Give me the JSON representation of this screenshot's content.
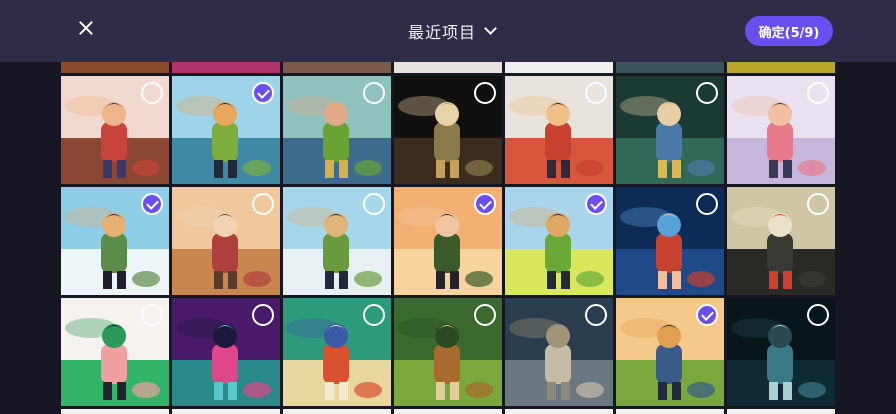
{
  "header": {
    "close_icon": "close-icon",
    "album_title": "最近项目",
    "album_dropdown_icon": "chevron-down-icon",
    "confirm_label": "确定(5/9)"
  },
  "colors": {
    "header_bg": "#2e2c47",
    "accent": "#6a4ff0",
    "page_bg": "#171623"
  },
  "selection": {
    "selected_count": 5,
    "max_count": 9
  },
  "grid": {
    "columns": 7,
    "top_partial_row": [
      "#8a4a2c",
      "#b0346a",
      "#7a5b4a",
      "#e8e3df",
      "#f1efee",
      "#38535e",
      "#b8a52c"
    ],
    "rows": [
      [
        {
          "theme": "girl-with-bag-brick-wall",
          "selected": false
        },
        {
          "theme": "boy-with-dog-city-bay",
          "selected": true
        },
        {
          "theme": "man-eating-in-green-jacket",
          "selected": false
        },
        {
          "theme": "archer-with-bow",
          "selected": false
        },
        {
          "theme": "man-sitting-on-books",
          "selected": false
        },
        {
          "theme": "warrior-in-forest",
          "selected": false
        },
        {
          "theme": "girl-in-cap-walking",
          "selected": false
        }
      ],
      [
        {
          "theme": "boy-with-dog-city-clouds",
          "selected": true
        },
        {
          "theme": "girl-hugging-dog",
          "selected": false
        },
        {
          "theme": "boy-with-dog-skyline",
          "selected": false
        },
        {
          "theme": "girl-with-cat-sunset",
          "selected": true
        },
        {
          "theme": "boy-with-dogs-meadow",
          "selected": true
        },
        {
          "theme": "girl-red-hair-night",
          "selected": false
        },
        {
          "theme": "wall-traffic-light",
          "selected": false
        }
      ],
      [
        {
          "theme": "person-green-table",
          "selected": false
        },
        {
          "theme": "woman-neon-purple",
          "selected": false
        },
        {
          "theme": "kid-with-milk-carton",
          "selected": false
        },
        {
          "theme": "person-in-tree",
          "selected": false
        },
        {
          "theme": "apartment-building",
          "selected": false
        },
        {
          "theme": "boy-with-dogs-sunset",
          "selected": true
        },
        {
          "theme": "dark-phone-booth",
          "selected": false
        }
      ]
    ]
  }
}
